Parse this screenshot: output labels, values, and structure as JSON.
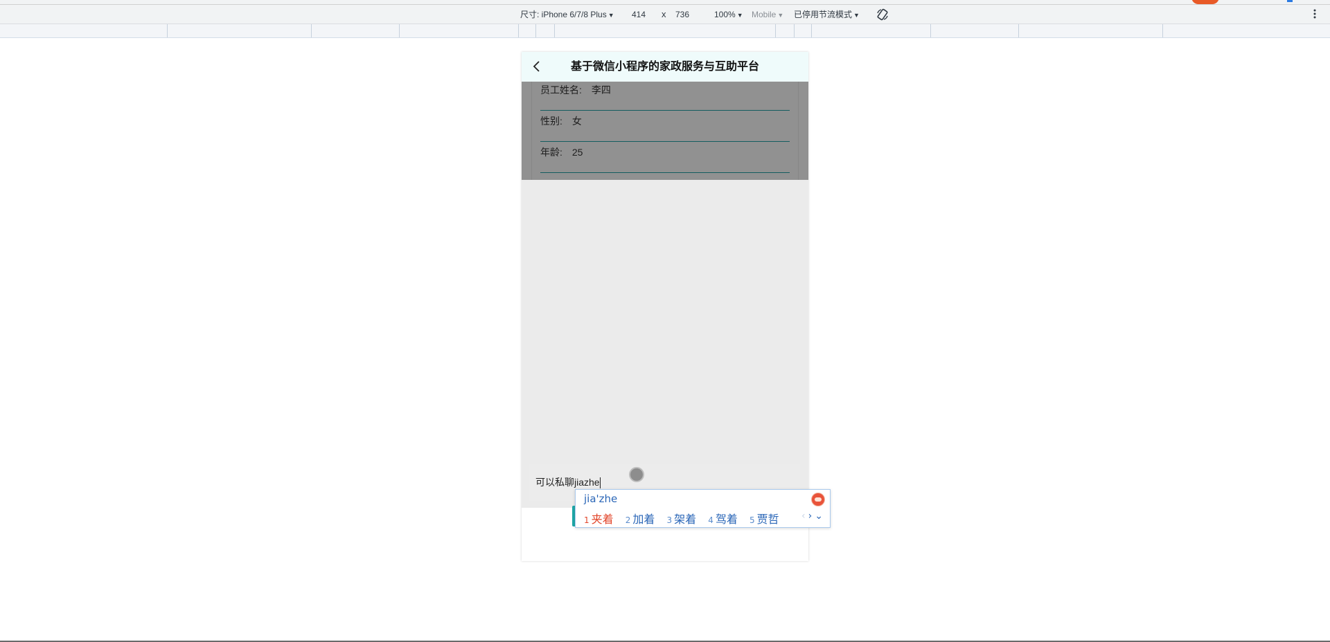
{
  "devtools": {
    "device_label": "尺寸: iPhone 6/7/8 Plus",
    "width": "414",
    "times": "x",
    "height": "736",
    "zoom": "100%",
    "mode": "Mobile",
    "throttle": "已停用节流模式",
    "rotate_icon": "rotate-icon",
    "more_icon": "more-vertical-icon"
  },
  "app": {
    "title": "基于微信小程序的家政服务与互助平台",
    "back_icon": "chevron-left-icon",
    "accent_color": "#1fa8a8"
  },
  "form": {
    "rows": [
      {
        "label": "员工姓名:",
        "value": "李四"
      },
      {
        "label": "性别:",
        "value": "女"
      },
      {
        "label": "年龄:",
        "value": "25"
      }
    ]
  },
  "chat": {
    "input_value": "可以私聊jiazhe"
  },
  "ime": {
    "composition": "jia'zhe",
    "candidates": [
      {
        "num": "1",
        "text": "夹着"
      },
      {
        "num": "2",
        "text": "加着"
      },
      {
        "num": "3",
        "text": "架着"
      },
      {
        "num": "4",
        "text": "驾着"
      },
      {
        "num": "5",
        "text": "贾哲"
      }
    ],
    "prev": "‹",
    "next": "›",
    "expand": "⌄"
  }
}
